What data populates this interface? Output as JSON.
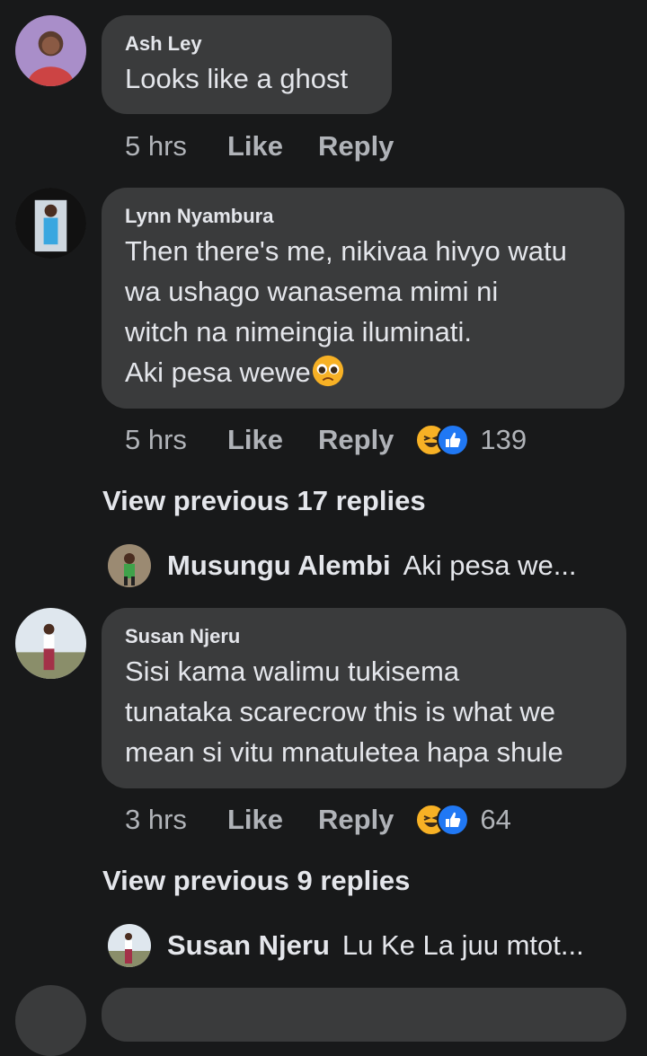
{
  "comments": [
    {
      "author": "Ash Ley",
      "lines": [
        "Looks like a ghost"
      ],
      "time": "5 hrs",
      "like_label": "Like",
      "reply_label": "Reply"
    },
    {
      "author": "Lynn Nyambura",
      "lines": [
        "Then there's me, nikivaa hivyo watu",
        "wa ushago wanasema mimi ni",
        "witch na nimeingia iluminati.",
        "Aki pesa wewe"
      ],
      "time": "5 hrs",
      "like_label": "Like",
      "reply_label": "Reply",
      "reactions": [
        "haha",
        "like"
      ],
      "reaction_count": "139",
      "emoji": "pleading-face"
    },
    {
      "author": "Susan Njeru",
      "lines": [
        "Sisi kama walimu tukisema",
        "tunataka scarecrow this is what we",
        "mean si vitu mnatuletea hapa shule"
      ],
      "time": "3 hrs",
      "like_label": "Like",
      "reply_label": "Reply",
      "reactions": [
        "haha",
        "like"
      ],
      "reaction_count": "64"
    }
  ],
  "thread1": {
    "view_previous": "View previous 17 replies",
    "preview_name": "Musungu Alembi",
    "preview_text": "Aki pesa we..."
  },
  "thread2": {
    "view_previous": "View previous 9 replies",
    "preview_name": "Susan Njeru",
    "preview_text": "Lu Ke La juu mtot..."
  },
  "colors": {
    "background": "#18191a",
    "bubble": "#3a3b3c",
    "text": "#e4e6eb",
    "muted": "#b0b3b8",
    "haha": "#f7b125",
    "like": "#2078f4"
  }
}
